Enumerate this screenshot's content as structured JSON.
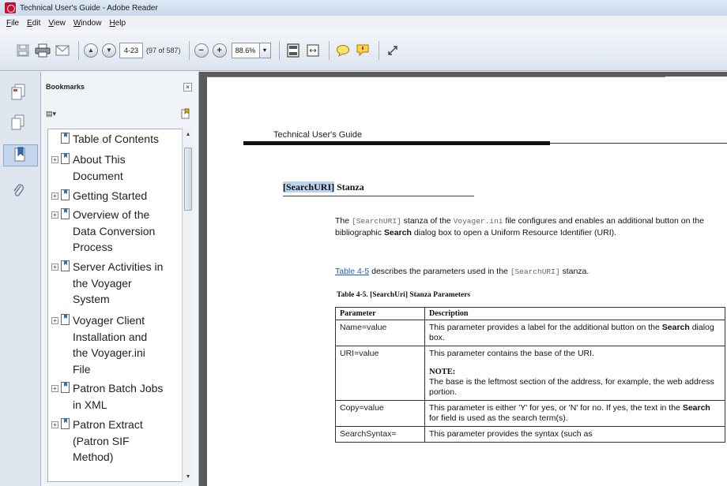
{
  "window": {
    "title": "Technical User's Guide - Adobe Reader"
  },
  "menu": [
    {
      "label": "File",
      "underline": "F",
      "rest": "ile"
    },
    {
      "label": "Edit",
      "underline": "E",
      "rest": "dit"
    },
    {
      "label": "View",
      "underline": "V",
      "rest": "iew"
    },
    {
      "label": "Window",
      "underline": "W",
      "rest": "indow"
    },
    {
      "label": "Help",
      "underline": "H",
      "rest": "elp"
    }
  ],
  "toolbar": {
    "page_value": "4-23",
    "page_count": "(97 of 587)",
    "zoom_value": "88.6%",
    "zoom_dropdown": "▾",
    "prev_glyph": "▲",
    "next_glyph": "▼",
    "zoom_out_glyph": "−",
    "zoom_in_glyph": "+"
  },
  "panel": {
    "title": "Bookmarks",
    "close_glyph": "×",
    "options_glyph": "▤▾"
  },
  "bookmarks": [
    {
      "lines": [
        "Table of Contents"
      ],
      "expandable": false
    },
    {
      "lines": [
        "About This",
        "Document"
      ],
      "expandable": true
    },
    {
      "lines": [
        "Getting Started"
      ],
      "expandable": true
    },
    {
      "lines": [
        "Overview of the",
        "Data Conversion",
        "Process"
      ],
      "expandable": true
    },
    {
      "lines": [
        "Server Activities in",
        "the Voyager",
        "System"
      ],
      "expandable": true
    },
    {
      "lines": [
        "Voyager Client",
        "Installation and",
        "the Voyager.ini",
        "File"
      ],
      "expandable": true
    },
    {
      "lines": [
        "Patron Batch Jobs",
        "in XML"
      ],
      "expandable": true
    },
    {
      "lines": [
        "Patron Extract",
        "(Patron SIF",
        "Method)"
      ],
      "expandable": true
    }
  ],
  "bookmark_text": {
    "b0": "Table of Contents",
    "b1": "About This Document",
    "b2": "Getting Started",
    "b3": "Overview of the Data Conversion Process",
    "b4": "Server Activities in the Voyager System",
    "b5": "Voyager Client Installation and the Voyager.ini File",
    "b6": "Patron Batch Jobs in XML",
    "b7": "Patron Extract (Patron SIF Method)"
  },
  "expand_glyph": "+",
  "document": {
    "running_head": "Technical User's Guide",
    "section_title_hl": "[SearchURI]",
    "section_title_rest": " Stanza",
    "p1_a": "The ",
    "p1_code1": "[SearchURI]",
    "p1_b": " stanza of the ",
    "p1_code2": "Voyager.ini",
    "p1_c": " file configures and enables an additional button on the bibliographic ",
    "p1_bold": "Search",
    "p1_d": " dialog box to open a Uniform Resource Identifier (URI).",
    "p2_link": "Table 4-5",
    "p2_a": " describes the parameters used in the ",
    "p2_code": "[SearchURI]",
    "p2_b": " stanza.",
    "table_caption": "Table 4-5.    [SearchUri] Stanza Parameters",
    "table_headers": [
      "Parameter",
      "Description"
    ],
    "rows": [
      {
        "param": "Name=value",
        "desc_a": "This parameter provides a label for the additional button on the ",
        "desc_bold": "Search",
        "desc_b": " dialog box."
      },
      {
        "param": "URI=value",
        "desc_a": "This parameter contains the base of the URI.",
        "note_head": "NOTE:",
        "note_text": "The base is the leftmost section of the address, for example, the web address portion."
      },
      {
        "param": "Copy=value",
        "desc_a": "This parameter is either 'Y' for yes, or 'N' for no. If yes, the text in the ",
        "desc_bold": "Search",
        "desc_b": " for field is used as the search term(s)."
      },
      {
        "param": "SearchSyntax=",
        "desc_a": "This parameter provides the syntax (such as"
      }
    ]
  }
}
